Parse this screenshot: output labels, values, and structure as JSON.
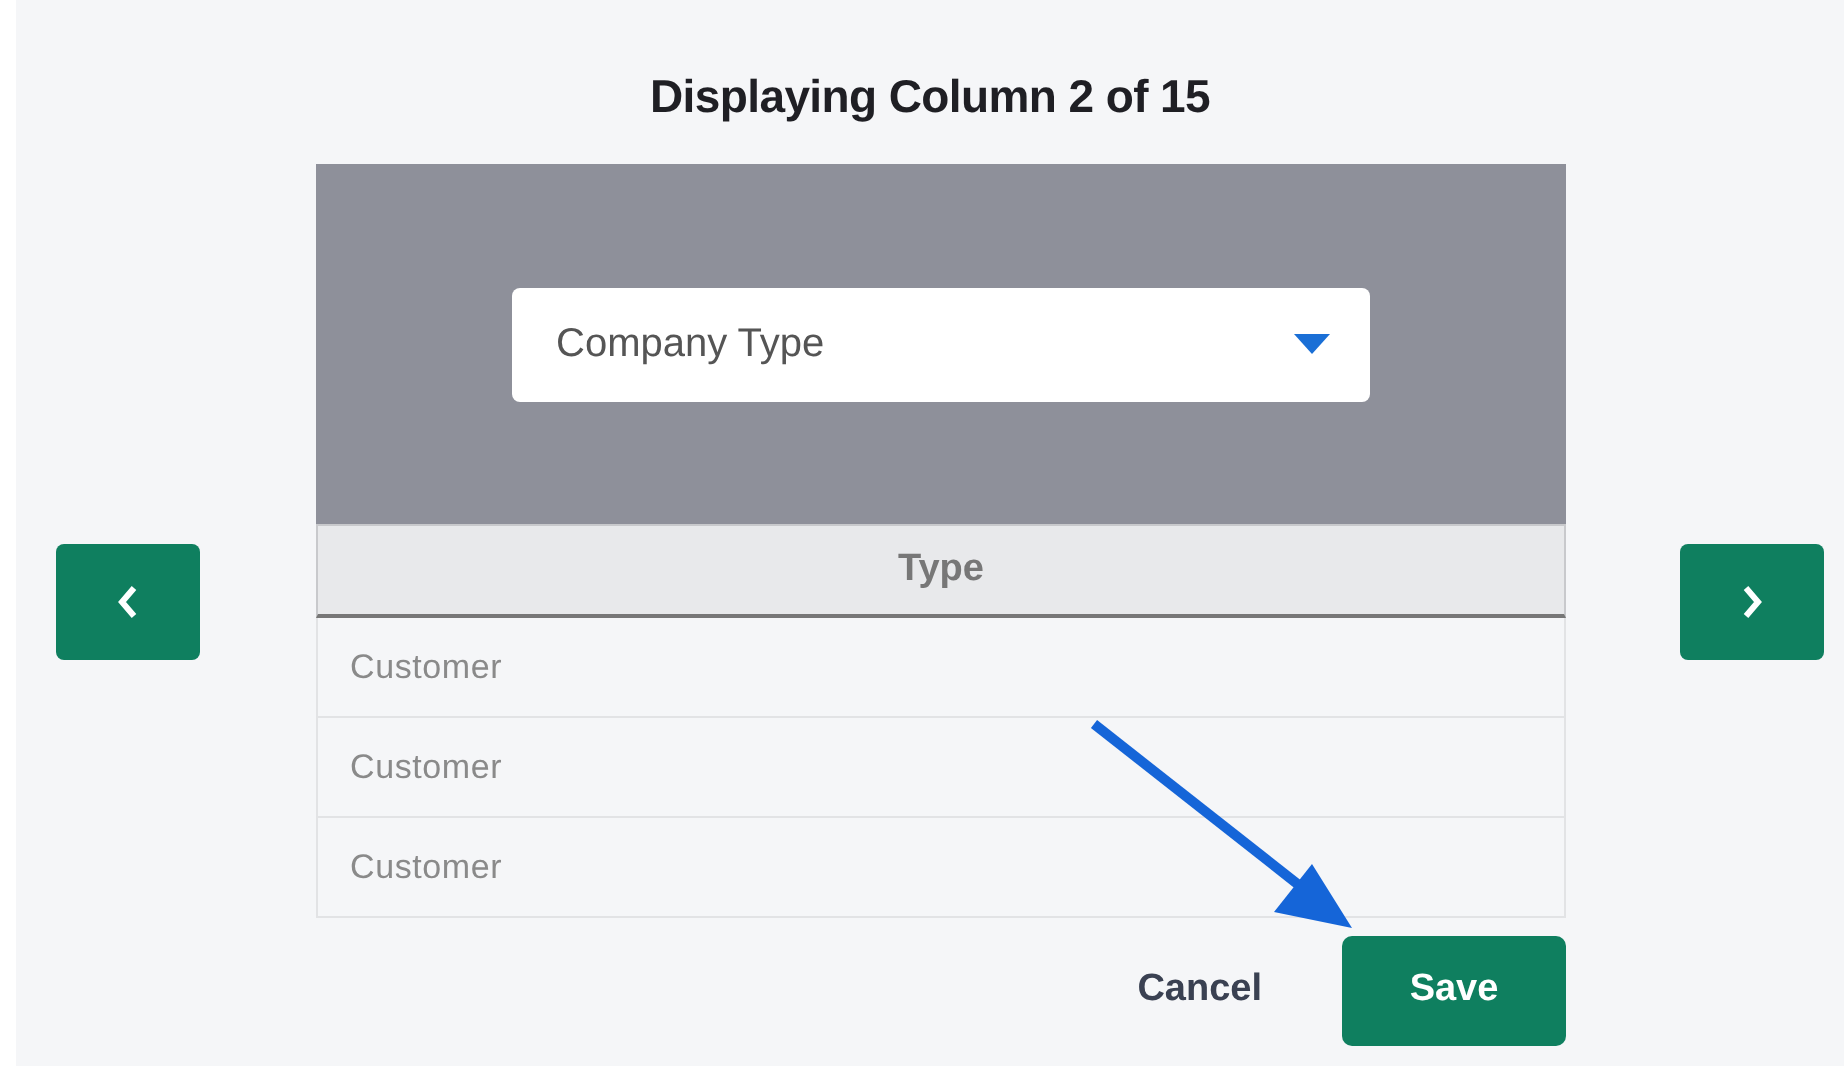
{
  "title": "Displaying Column 2 of 15",
  "dropdown": {
    "value": "Company Type"
  },
  "table": {
    "columns": [
      "Type"
    ],
    "rows": [
      [
        "Customer"
      ],
      [
        "Customer"
      ],
      [
        "Customer"
      ]
    ]
  },
  "buttons": [
    {
      "label": "Cancel",
      "kind": "link"
    },
    {
      "label": "Save",
      "kind": "primary"
    }
  ]
}
